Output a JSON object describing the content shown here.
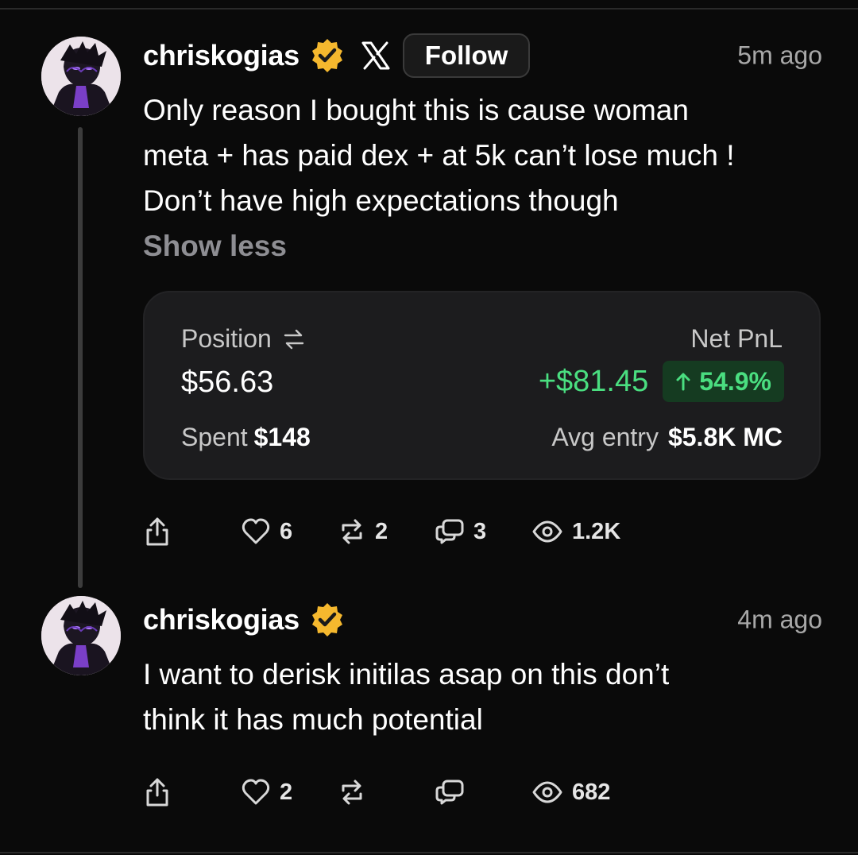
{
  "colors": {
    "background": "#0a0a0a",
    "verified_badge": "#f5b82e",
    "positive": "#4ade80",
    "positive_bg": "#153b21",
    "muted_text": "#8e8e93"
  },
  "posts": [
    {
      "username": "chriskogias",
      "verified": true,
      "platform_icon": "x-logo-icon",
      "follow_label": "Follow",
      "timestamp": "5m ago",
      "text": "Only reason I bought this is cause woman\nmeta + has paid dex + at 5k can’t lose much !\nDon’t have high expectations though",
      "show_less_label": "Show less",
      "position_card": {
        "position_label": "Position",
        "position_value": "$56.63",
        "spent_label": "Spent",
        "spent_value": "$148",
        "net_pnl_label": "Net PnL",
        "net_pnl_value": "+$81.45",
        "pnl_percent": "54.9%",
        "avg_entry_label": "Avg entry",
        "avg_entry_value": "$5.8K MC"
      },
      "actions": {
        "likes": "6",
        "reposts": "2",
        "comments": "3",
        "views": "1.2K"
      }
    },
    {
      "username": "chriskogias",
      "verified": true,
      "timestamp": "4m ago",
      "text": "I want to derisk initilas asap on this don’t\nthink it has much potential",
      "actions": {
        "likes": "2",
        "reposts": "",
        "comments": "",
        "views": "682"
      }
    }
  ]
}
